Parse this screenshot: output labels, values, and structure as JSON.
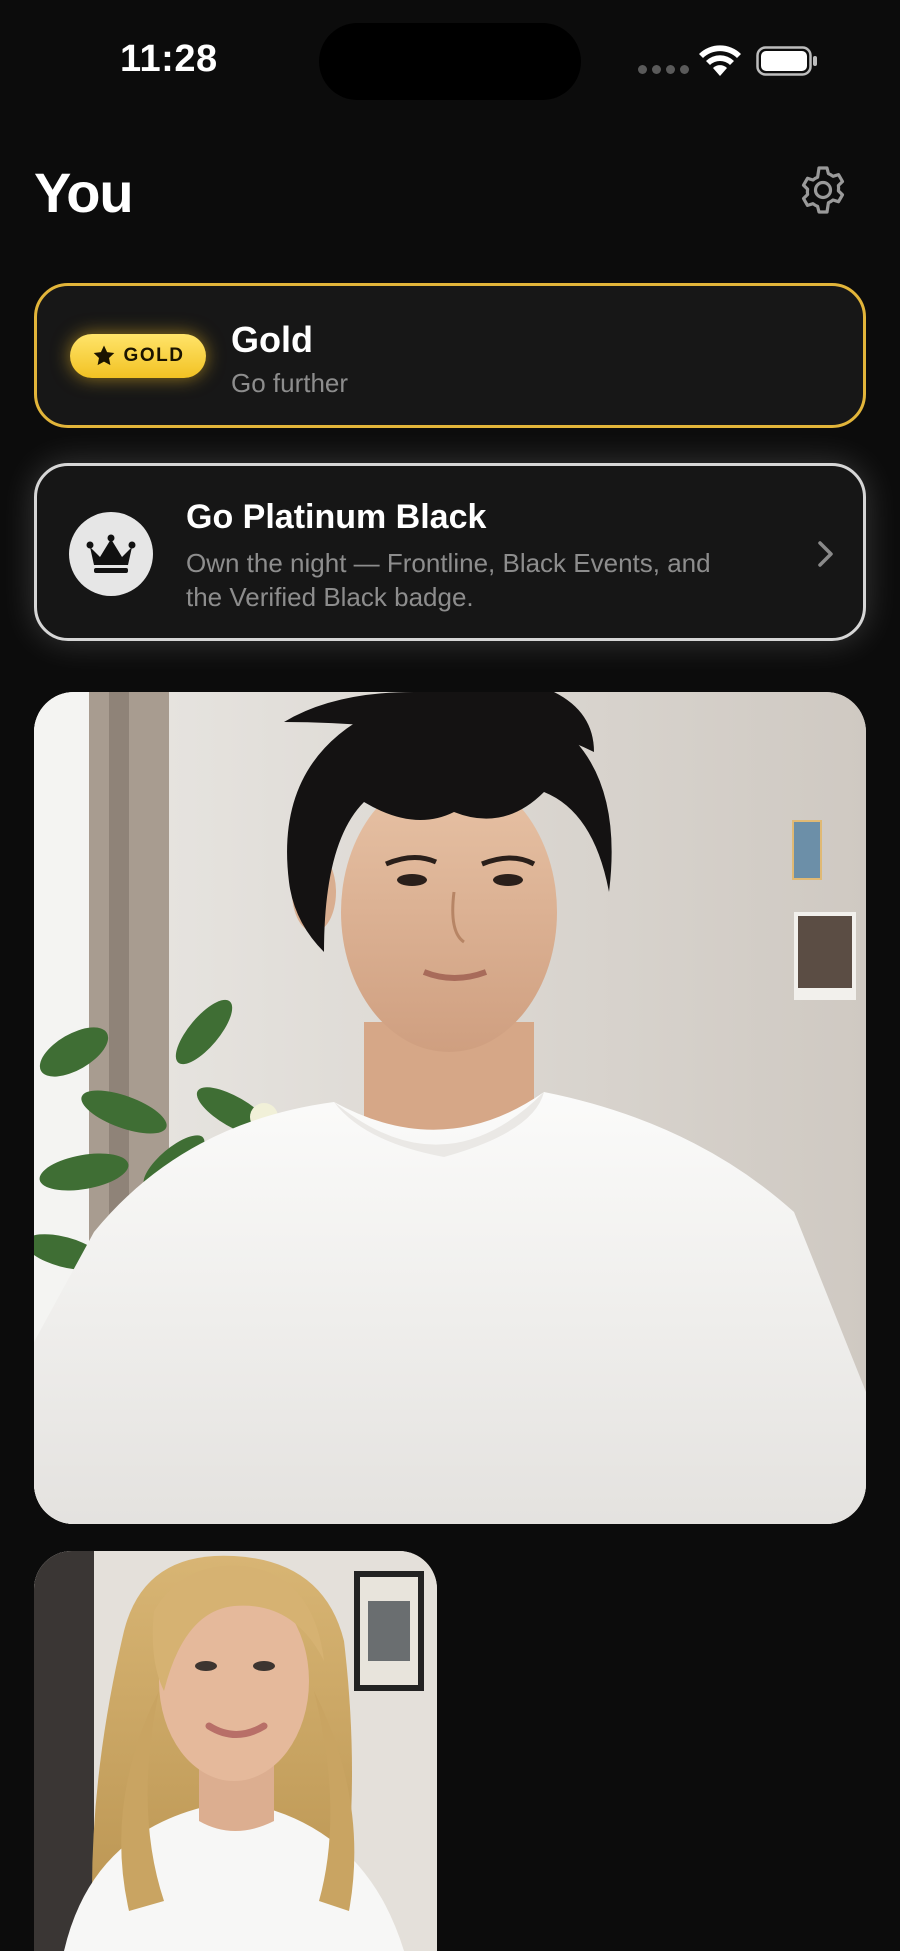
{
  "status_bar": {
    "time": "11:28"
  },
  "header": {
    "title": "You",
    "settings_icon": "gear-icon"
  },
  "gold_card": {
    "badge_text": "GOLD",
    "badge_icon": "star-icon",
    "title": "Gold",
    "subtitle": "Go further",
    "accent_color": "#e2b53a"
  },
  "platinum_card": {
    "icon": "crown-icon",
    "title": "Go Platinum Black",
    "description": "Own the night — Frontline, Black Events, and the Verified Black badge.",
    "chevron_icon": "chevron-right-icon",
    "border_color": "#d6d6d6"
  },
  "photos": {
    "primary": "profile-photo-man-white-tshirt",
    "secondary": "profile-photo-woman-blonde"
  }
}
